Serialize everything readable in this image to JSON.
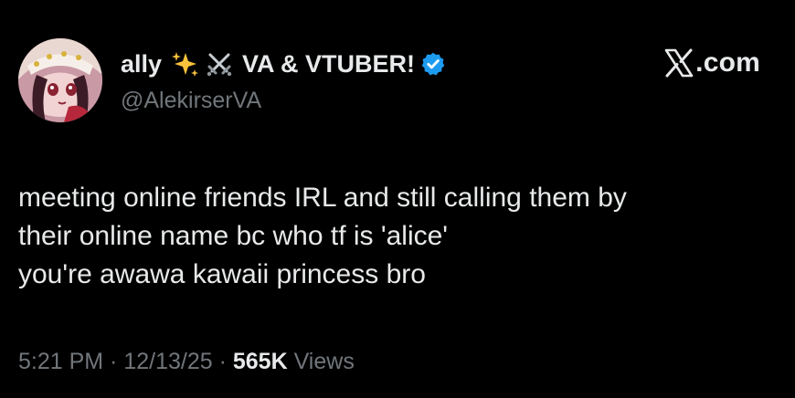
{
  "author": {
    "display_name": "ally",
    "display_name_suffix": "VA & VTUBER!",
    "handle": "@AlekirserVA",
    "emojis": [
      "sparkles-icon",
      "crossed-swords-icon"
    ],
    "verified": true
  },
  "brand": {
    "logo": "x-logo-icon",
    "text": ".com"
  },
  "tweet": {
    "lines": [
      "meeting online friends IRL and still calling them by",
      "their online name bc who tf is 'alice'",
      "you're awawa kawaii princess bro"
    ]
  },
  "meta": {
    "time": "5:21 PM",
    "sep1": " · ",
    "date": "12/13/25",
    "sep2": " · ",
    "views_count": "565K",
    "views_label": " Views"
  },
  "colors": {
    "background": "#000000",
    "primary_text": "#e7e9ea",
    "secondary_text": "#71767b",
    "verified_badge": "#1d9bf0"
  }
}
